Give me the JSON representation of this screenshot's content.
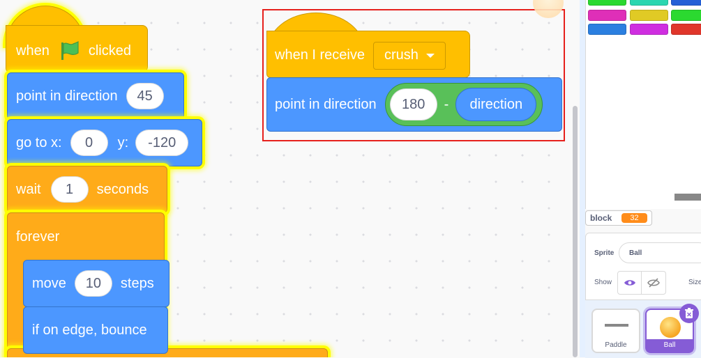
{
  "script1": {
    "hat": {
      "when": "when",
      "clicked": "clicked"
    },
    "point": {
      "label": "point in direction",
      "value": "45"
    },
    "goto": {
      "label_x": "go to x:",
      "x": "0",
      "label_y": "y:",
      "y": "-120"
    },
    "wait": {
      "label": "wait",
      "value": "1",
      "suffix": "seconds"
    },
    "forever": {
      "label": "forever"
    },
    "move": {
      "label": "move",
      "value": "10",
      "suffix": "steps"
    },
    "bounce": {
      "label": "if on edge, bounce"
    }
  },
  "script2": {
    "hat": {
      "label": "when I receive",
      "message": "crush"
    },
    "point": {
      "label": "point in direction",
      "left_operand": "180",
      "operator": "-",
      "reporter": "direction"
    }
  },
  "colors": {
    "motion": "#4c97ff",
    "events": "#ffbf00",
    "control": "#ffab19",
    "operators": "#59c059",
    "highlight": "#ff0000",
    "glow": "#ffff00"
  },
  "monitor": {
    "name": "block",
    "value": "32"
  },
  "sprite_info": {
    "sprite_label": "Sprite",
    "sprite_name": "Ball",
    "show_label": "Show",
    "size_label": "Size"
  },
  "sprites": [
    {
      "name": "Paddle",
      "selected": false
    },
    {
      "name": "Ball",
      "selected": true
    }
  ],
  "icons": {
    "flag": "green-flag-icon",
    "dropdown": "dropdown-caret-icon",
    "show": "eye-icon",
    "hide": "eye-slash-icon",
    "delete": "trash-icon"
  }
}
